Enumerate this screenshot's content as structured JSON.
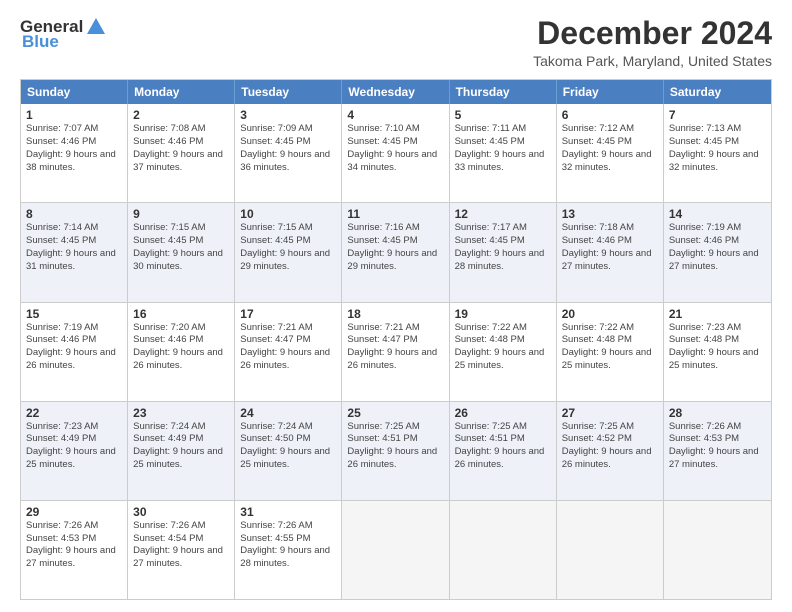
{
  "logo": {
    "general": "General",
    "blue": "Blue"
  },
  "title": "December 2024",
  "subtitle": "Takoma Park, Maryland, United States",
  "calendar": {
    "headers": [
      "Sunday",
      "Monday",
      "Tuesday",
      "Wednesday",
      "Thursday",
      "Friday",
      "Saturday"
    ],
    "rows": [
      [
        {
          "day": "1",
          "sunrise": "Sunrise: 7:07 AM",
          "sunset": "Sunset: 4:46 PM",
          "daylight": "Daylight: 9 hours and 38 minutes."
        },
        {
          "day": "2",
          "sunrise": "Sunrise: 7:08 AM",
          "sunset": "Sunset: 4:46 PM",
          "daylight": "Daylight: 9 hours and 37 minutes."
        },
        {
          "day": "3",
          "sunrise": "Sunrise: 7:09 AM",
          "sunset": "Sunset: 4:45 PM",
          "daylight": "Daylight: 9 hours and 36 minutes."
        },
        {
          "day": "4",
          "sunrise": "Sunrise: 7:10 AM",
          "sunset": "Sunset: 4:45 PM",
          "daylight": "Daylight: 9 hours and 34 minutes."
        },
        {
          "day": "5",
          "sunrise": "Sunrise: 7:11 AM",
          "sunset": "Sunset: 4:45 PM",
          "daylight": "Daylight: 9 hours and 33 minutes."
        },
        {
          "day": "6",
          "sunrise": "Sunrise: 7:12 AM",
          "sunset": "Sunset: 4:45 PM",
          "daylight": "Daylight: 9 hours and 32 minutes."
        },
        {
          "day": "7",
          "sunrise": "Sunrise: 7:13 AM",
          "sunset": "Sunset: 4:45 PM",
          "daylight": "Daylight: 9 hours and 32 minutes."
        }
      ],
      [
        {
          "day": "8",
          "sunrise": "Sunrise: 7:14 AM",
          "sunset": "Sunset: 4:45 PM",
          "daylight": "Daylight: 9 hours and 31 minutes."
        },
        {
          "day": "9",
          "sunrise": "Sunrise: 7:15 AM",
          "sunset": "Sunset: 4:45 PM",
          "daylight": "Daylight: 9 hours and 30 minutes."
        },
        {
          "day": "10",
          "sunrise": "Sunrise: 7:15 AM",
          "sunset": "Sunset: 4:45 PM",
          "daylight": "Daylight: 9 hours and 29 minutes."
        },
        {
          "day": "11",
          "sunrise": "Sunrise: 7:16 AM",
          "sunset": "Sunset: 4:45 PM",
          "daylight": "Daylight: 9 hours and 29 minutes."
        },
        {
          "day": "12",
          "sunrise": "Sunrise: 7:17 AM",
          "sunset": "Sunset: 4:45 PM",
          "daylight": "Daylight: 9 hours and 28 minutes."
        },
        {
          "day": "13",
          "sunrise": "Sunrise: 7:18 AM",
          "sunset": "Sunset: 4:46 PM",
          "daylight": "Daylight: 9 hours and 27 minutes."
        },
        {
          "day": "14",
          "sunrise": "Sunrise: 7:19 AM",
          "sunset": "Sunset: 4:46 PM",
          "daylight": "Daylight: 9 hours and 27 minutes."
        }
      ],
      [
        {
          "day": "15",
          "sunrise": "Sunrise: 7:19 AM",
          "sunset": "Sunset: 4:46 PM",
          "daylight": "Daylight: 9 hours and 26 minutes."
        },
        {
          "day": "16",
          "sunrise": "Sunrise: 7:20 AM",
          "sunset": "Sunset: 4:46 PM",
          "daylight": "Daylight: 9 hours and 26 minutes."
        },
        {
          "day": "17",
          "sunrise": "Sunrise: 7:21 AM",
          "sunset": "Sunset: 4:47 PM",
          "daylight": "Daylight: 9 hours and 26 minutes."
        },
        {
          "day": "18",
          "sunrise": "Sunrise: 7:21 AM",
          "sunset": "Sunset: 4:47 PM",
          "daylight": "Daylight: 9 hours and 26 minutes."
        },
        {
          "day": "19",
          "sunrise": "Sunrise: 7:22 AM",
          "sunset": "Sunset: 4:48 PM",
          "daylight": "Daylight: 9 hours and 25 minutes."
        },
        {
          "day": "20",
          "sunrise": "Sunrise: 7:22 AM",
          "sunset": "Sunset: 4:48 PM",
          "daylight": "Daylight: 9 hours and 25 minutes."
        },
        {
          "day": "21",
          "sunrise": "Sunrise: 7:23 AM",
          "sunset": "Sunset: 4:48 PM",
          "daylight": "Daylight: 9 hours and 25 minutes."
        }
      ],
      [
        {
          "day": "22",
          "sunrise": "Sunrise: 7:23 AM",
          "sunset": "Sunset: 4:49 PM",
          "daylight": "Daylight: 9 hours and 25 minutes."
        },
        {
          "day": "23",
          "sunrise": "Sunrise: 7:24 AM",
          "sunset": "Sunset: 4:49 PM",
          "daylight": "Daylight: 9 hours and 25 minutes."
        },
        {
          "day": "24",
          "sunrise": "Sunrise: 7:24 AM",
          "sunset": "Sunset: 4:50 PM",
          "daylight": "Daylight: 9 hours and 25 minutes."
        },
        {
          "day": "25",
          "sunrise": "Sunrise: 7:25 AM",
          "sunset": "Sunset: 4:51 PM",
          "daylight": "Daylight: 9 hours and 26 minutes."
        },
        {
          "day": "26",
          "sunrise": "Sunrise: 7:25 AM",
          "sunset": "Sunset: 4:51 PM",
          "daylight": "Daylight: 9 hours and 26 minutes."
        },
        {
          "day": "27",
          "sunrise": "Sunrise: 7:25 AM",
          "sunset": "Sunset: 4:52 PM",
          "daylight": "Daylight: 9 hours and 26 minutes."
        },
        {
          "day": "28",
          "sunrise": "Sunrise: 7:26 AM",
          "sunset": "Sunset: 4:53 PM",
          "daylight": "Daylight: 9 hours and 27 minutes."
        }
      ],
      [
        {
          "day": "29",
          "sunrise": "Sunrise: 7:26 AM",
          "sunset": "Sunset: 4:53 PM",
          "daylight": "Daylight: 9 hours and 27 minutes."
        },
        {
          "day": "30",
          "sunrise": "Sunrise: 7:26 AM",
          "sunset": "Sunset: 4:54 PM",
          "daylight": "Daylight: 9 hours and 27 minutes."
        },
        {
          "day": "31",
          "sunrise": "Sunrise: 7:26 AM",
          "sunset": "Sunset: 4:55 PM",
          "daylight": "Daylight: 9 hours and 28 minutes."
        },
        {
          "day": "",
          "sunrise": "",
          "sunset": "",
          "daylight": ""
        },
        {
          "day": "",
          "sunrise": "",
          "sunset": "",
          "daylight": ""
        },
        {
          "day": "",
          "sunrise": "",
          "sunset": "",
          "daylight": ""
        },
        {
          "day": "",
          "sunrise": "",
          "sunset": "",
          "daylight": ""
        }
      ]
    ]
  }
}
